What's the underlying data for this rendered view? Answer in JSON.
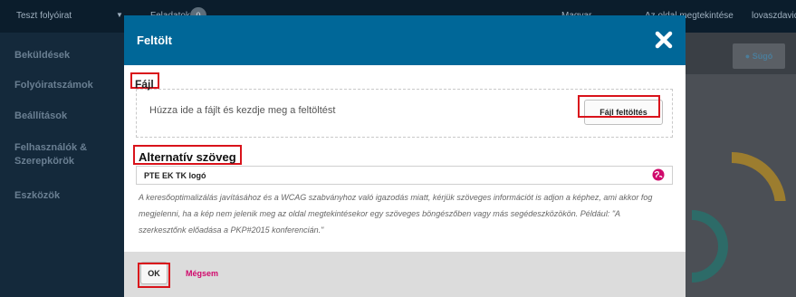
{
  "topbar": {
    "site_name": "Teszt folyóirat",
    "dropdown_glyph": "▼",
    "tasks_label": "Feladatok",
    "tasks_count": "0",
    "link_1": "Magyar",
    "link_2": "Az oldal megtekintése",
    "user": "lovaszdavid"
  },
  "sidebar": {
    "items": [
      {
        "label": "Beküldések"
      },
      {
        "label": "Folyóiratszámok"
      },
      {
        "label": "Beállítások"
      },
      {
        "label": "Felhasználók & Szerepkörök"
      },
      {
        "label": "Eszközök"
      }
    ]
  },
  "background": {
    "help_label": "Súgó"
  },
  "modal": {
    "title": "Feltölt",
    "close_icon": "close-icon",
    "file_section": {
      "label": "Fájl",
      "dropzone_text": "Húzza ide a fájlt és kezdje meg a feltöltést",
      "upload_button": "Fájl feltöltés"
    },
    "alt_section": {
      "label": "Alternatív szöveg",
      "value": "PTE EK TK logó",
      "help": "A keresőoptimalizálás javításához és a WCAG szabványhoz való igazodás miatt, kérjük szöveges információt is adjon a képhez, ami akkor fog megjelenni, ha a kép nem jelenik meg az oldal megtekintésekor egy szöveges böngészőben vagy más segédeszközökön. Például: \"A szerkesztőnk előadása a PKP#2015 konferencián.\""
    },
    "footer": {
      "ok": "OK",
      "cancel": "Mégsem"
    }
  },
  "colors": {
    "header_bg": "#006798",
    "highlight": "#d9131b",
    "cancel_link": "#d00a6c",
    "globe_icon": "#d00a6c"
  }
}
